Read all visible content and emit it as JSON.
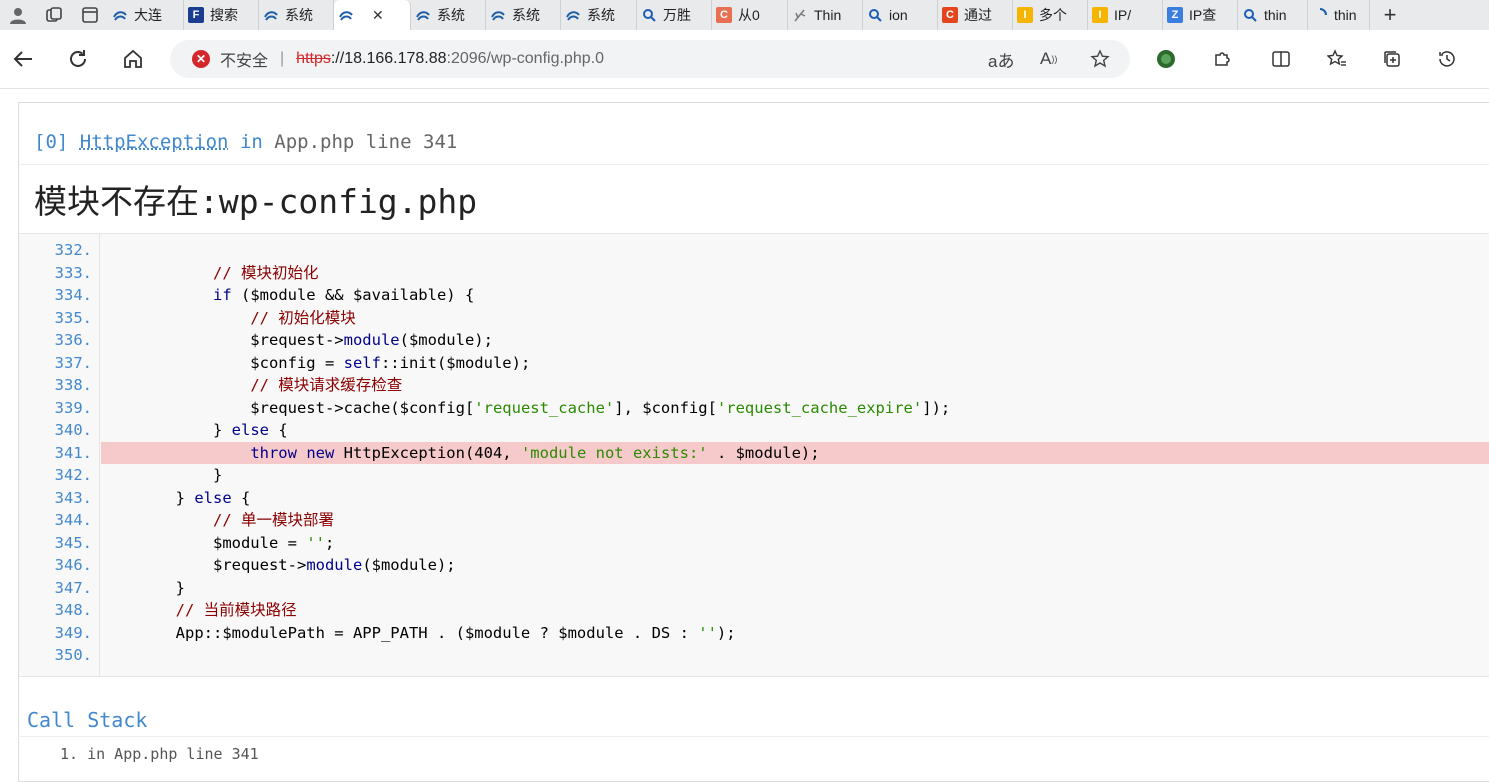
{
  "tabs": [
    {
      "label": "大连",
      "icon_name": "site-swirl-icon",
      "color": "#1f5fa8"
    },
    {
      "label": "搜索",
      "icon_name": "site-f-icon",
      "color": "#1a3d8f"
    },
    {
      "label": "系统",
      "icon_name": "site-swirl-icon",
      "color": "#1f5fa8"
    },
    {
      "label": "",
      "icon_name": "site-swirl-icon",
      "color": "#1f5fa8",
      "active": true
    },
    {
      "label": "系统",
      "icon_name": "site-swirl-icon",
      "color": "#1f5fa8"
    },
    {
      "label": "系统",
      "icon_name": "site-swirl-icon",
      "color": "#1f5fa8"
    },
    {
      "label": "系统",
      "icon_name": "site-swirl-icon",
      "color": "#1f5fa8"
    },
    {
      "label": "万胜",
      "icon_name": "search-icon",
      "color": "#1a5fb4"
    },
    {
      "label": "从0",
      "icon_name": "site-c-icon",
      "color": "#e86f52"
    },
    {
      "label": "Thin",
      "icon_name": "site-feather-icon",
      "color": "#777777"
    },
    {
      "label": "ion",
      "icon_name": "search-icon",
      "color": "#1a5fb4"
    },
    {
      "label": "通过",
      "icon_name": "site-c-icon",
      "color": "#e3461f"
    },
    {
      "label": "多个",
      "icon_name": "site-ip-icon",
      "color": "#f4b400"
    },
    {
      "label": "IP/",
      "icon_name": "site-ip-icon",
      "color": "#f4b400"
    },
    {
      "label": "IP查",
      "icon_name": "site-z-icon",
      "color": "#3b7de0"
    },
    {
      "label": "thin",
      "icon_name": "search-icon",
      "color": "#1a5fb4"
    },
    {
      "label": "thin",
      "icon_name": "loading-icon",
      "color": "#1a5fb4"
    }
  ],
  "address_bar": {
    "security_label": "不安全",
    "url_scheme": "https",
    "url_host": "://18.166.178.88",
    "url_path": ":2096/wp-config.php.0"
  },
  "exception": {
    "index": "[0]",
    "class_name": "HttpException",
    "in_label": "in",
    "file": "App.php line 341",
    "message_cn": "模块不存在",
    "message_tail": ":wp-config.php"
  },
  "source": {
    "lines": [
      {
        "n": "332.",
        "html": ""
      },
      {
        "n": "333.",
        "html": "            <span class=\"c\">// 模块初始化</span>"
      },
      {
        "n": "334.",
        "html": "            <span class=\"k\">if</span> ($module &amp;&amp; $available) {"
      },
      {
        "n": "335.",
        "html": "                <span class=\"c\">// 初始化模块</span>"
      },
      {
        "n": "336.",
        "html": "                $request-&gt;<span class=\"k\">module</span>($module);"
      },
      {
        "n": "337.",
        "html": "                $config = <span class=\"k\">self</span>::init($module);"
      },
      {
        "n": "338.",
        "html": "                <span class=\"c\">// 模块请求缓存检查</span>"
      },
      {
        "n": "339.",
        "html": "                $request-&gt;cache($config[<span class=\"s\">'request_cache'</span>], $config[<span class=\"s\">'request_cache_expire'</span>]);"
      },
      {
        "n": "340.",
        "html": "            } <span class=\"k\">else</span> {"
      },
      {
        "n": "341.",
        "html": "                <span class=\"k\">throw</span> <span class=\"k\">new</span> HttpException(404, <span class=\"s\">'module not exists:'</span> . $module);",
        "highlight": true
      },
      {
        "n": "342.",
        "html": "            }"
      },
      {
        "n": "343.",
        "html": "        } <span class=\"k\">else</span> {"
      },
      {
        "n": "344.",
        "html": "            <span class=\"c\">// 单一模块部署</span>"
      },
      {
        "n": "345.",
        "html": "            $module = <span class=\"s\">''</span>;"
      },
      {
        "n": "346.",
        "html": "            $request-&gt;<span class=\"k\">module</span>($module);"
      },
      {
        "n": "347.",
        "html": "        }"
      },
      {
        "n": "348.",
        "html": "        <span class=\"c\">// 当前模块路径</span>"
      },
      {
        "n": "349.",
        "html": "        App::$modulePath = APP_PATH . ($module ? $module . DS : <span class=\"s\">''</span>);"
      },
      {
        "n": "350.",
        "html": ""
      }
    ]
  },
  "call_stack": {
    "title": "Call Stack",
    "first_item": "1.  in App.php line 341"
  }
}
